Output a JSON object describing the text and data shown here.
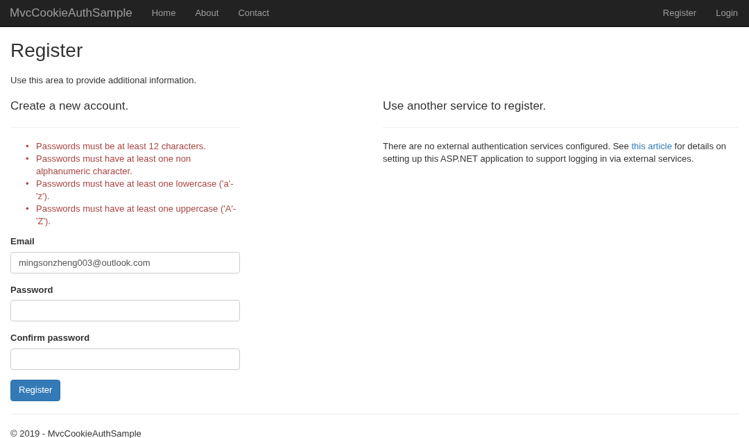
{
  "navbar": {
    "brand": "MvcCookieAuthSample",
    "links": [
      "Home",
      "About",
      "Contact"
    ],
    "right_links": [
      "Register",
      "Login"
    ]
  },
  "page": {
    "title": "Register",
    "subtitle": "Use this area to provide additional information."
  },
  "register_form": {
    "heading": "Create a new account.",
    "errors": [
      {
        "marker": "•",
        "text": "Passwords must be at least 12 characters."
      },
      {
        "marker": "•",
        "text": "Passwords must have at least one non alphanumeric character."
      },
      {
        "marker": "•",
        "text": "Passwords must have at least one lowercase ('a'-'z')."
      },
      {
        "marker": "•",
        "text": "Passwords must have at least one uppercase ('A'-'Z')."
      }
    ],
    "fields": [
      {
        "label": "Email",
        "value": "mingsonzheng003@outlook.com"
      },
      {
        "label": "Password"
      },
      {
        "label": "Confirm password"
      }
    ],
    "submit": "Register"
  },
  "external": {
    "heading": "Use another service to register.",
    "text_before": "There are no external authentication services configured. See ",
    "link": "this article",
    "text_after": " for details on setting up this ASP.NET application to support logging in via external services."
  },
  "footer": "© 2019 - MvcCookieAuthSample"
}
